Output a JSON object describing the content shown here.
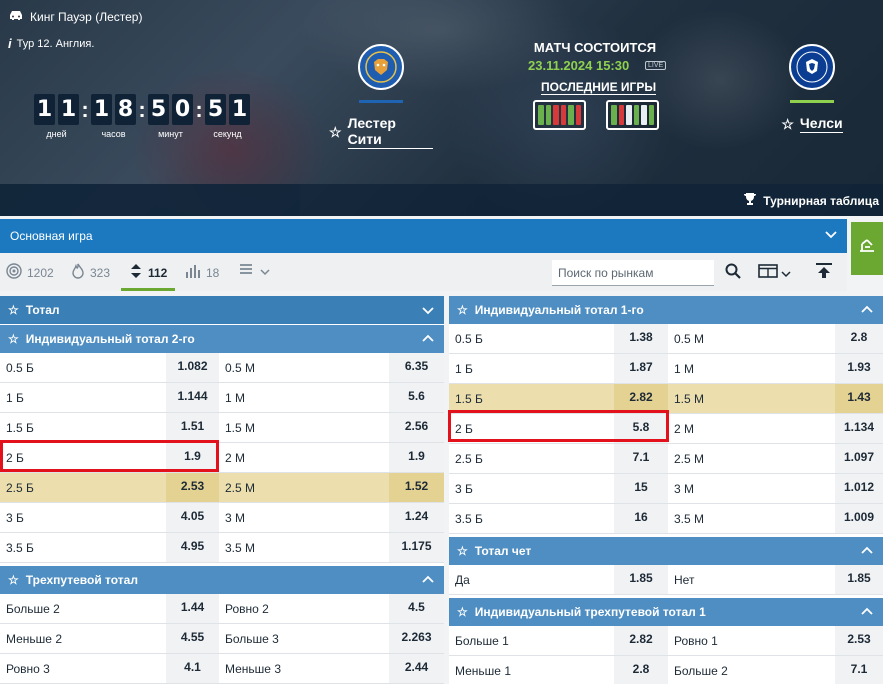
{
  "header": {
    "tournament": "Кинг Пауэр (Лестер)",
    "round": "Тур 12. Англия.",
    "timer": {
      "days": [
        "1",
        "1"
      ],
      "hours": [
        "1",
        "8"
      ],
      "minutes": [
        "5",
        "0"
      ],
      "seconds": [
        "5",
        "1"
      ],
      "labels": {
        "days": "дней",
        "hours": "часов",
        "minutes": "минут",
        "seconds": "секунд"
      }
    },
    "home_team": "Лестер Сити",
    "away_team": "Челси",
    "match_status": "МАТЧ СОСТОИТСЯ",
    "match_date": "23.11.2024 15:30",
    "live_badge": "LIVE",
    "last_games": "ПОСЛЕДНИЕ ИГРЫ",
    "tournament_table": "Турнирная таблица",
    "colors": {
      "home": "#1f63b3",
      "away": "#8fd14f",
      "date": "#8fd14f"
    }
  },
  "main_game": "Основная игра",
  "filters": {
    "items": [
      {
        "icon": "target-icon",
        "count": "1202"
      },
      {
        "icon": "fire-icon",
        "count": "323"
      },
      {
        "icon": "sort-icon",
        "count": "112"
      },
      {
        "icon": "stats-icon",
        "count": "18"
      }
    ],
    "search_placeholder": "Поиск по рынкам"
  },
  "left": {
    "total_title": "Тотал",
    "ind2_title": "Индивидуальный тотал 2-го",
    "ind2_rows": [
      {
        "l": "0.5 Б",
        "lo": "1.082",
        "r": "0.5 М",
        "ro": "6.35"
      },
      {
        "l": "1 Б",
        "lo": "1.144",
        "r": "1 М",
        "ro": "5.6"
      },
      {
        "l": "1.5 Б",
        "lo": "1.51",
        "r": "1.5 М",
        "ro": "2.56"
      },
      {
        "l": "2 Б",
        "lo": "1.9",
        "r": "2 М",
        "ro": "1.9"
      },
      {
        "l": "2.5 Б",
        "lo": "2.53",
        "r": "2.5 М",
        "ro": "1.52"
      },
      {
        "l": "3 Б",
        "lo": "4.05",
        "r": "3 М",
        "ro": "1.24"
      },
      {
        "l": "3.5 Б",
        "lo": "4.95",
        "r": "3.5 М",
        "ro": "1.175"
      }
    ],
    "three_title": "Трехпутевой тотал",
    "three_rows": [
      {
        "l": "Больше 2",
        "lo": "1.44",
        "r": "Ровно 2",
        "ro": "4.5"
      },
      {
        "l": "Меньше 2",
        "lo": "4.55",
        "r": "Больше 3",
        "ro": "2.263"
      },
      {
        "l": "Ровно 3",
        "lo": "4.1",
        "r": "Меньше 3",
        "ro": "2.44"
      }
    ]
  },
  "right": {
    "ind1_title": "Индивидуальный тотал 1-го",
    "ind1_rows": [
      {
        "l": "0.5 Б",
        "lo": "1.38",
        "r": "0.5 М",
        "ro": "2.8"
      },
      {
        "l": "1 Б",
        "lo": "1.87",
        "r": "1 М",
        "ro": "1.93"
      },
      {
        "l": "1.5 Б",
        "lo": "2.82",
        "r": "1.5 М",
        "ro": "1.43"
      },
      {
        "l": "2 Б",
        "lo": "5.8",
        "r": "2 М",
        "ro": "1.134"
      },
      {
        "l": "2.5 Б",
        "lo": "7.1",
        "r": "2.5 М",
        "ro": "1.097"
      },
      {
        "l": "3 Б",
        "lo": "15",
        "r": "3 М",
        "ro": "1.012"
      },
      {
        "l": "3.5 Б",
        "lo": "16",
        "r": "3.5 М",
        "ro": "1.009"
      }
    ],
    "even_title": "Тотал чет",
    "even_rows": [
      {
        "l": "Да",
        "lo": "1.85",
        "r": "Нет",
        "ro": "1.85"
      }
    ],
    "ind3_title": "Индивидуальный трехпутевой тотал 1",
    "ind3_rows": [
      {
        "l": "Больше 1",
        "lo": "2.82",
        "r": "Ровно 1",
        "ro": "2.53"
      },
      {
        "l": "Меньше 1",
        "lo": "2.8",
        "r": "Больше 2",
        "ro": "7.1"
      }
    ]
  }
}
